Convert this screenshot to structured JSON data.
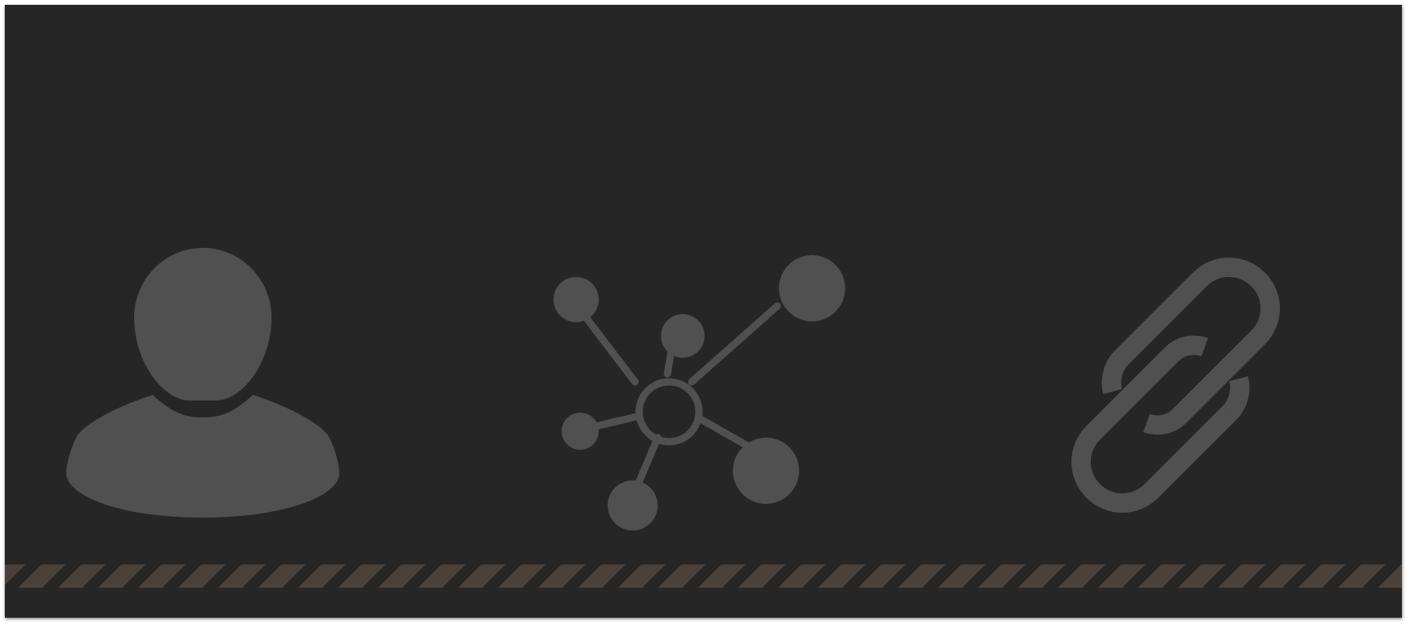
{
  "theme": {
    "background": "#262626",
    "icon_color": "#505050",
    "stripe_color": "#4b4139",
    "page_background": "#ffffff"
  },
  "icons": [
    {
      "name": "user-icon"
    },
    {
      "name": "network-icon"
    },
    {
      "name": "link-icon"
    }
  ],
  "footer": {
    "pattern": "diagonal-stripes"
  }
}
